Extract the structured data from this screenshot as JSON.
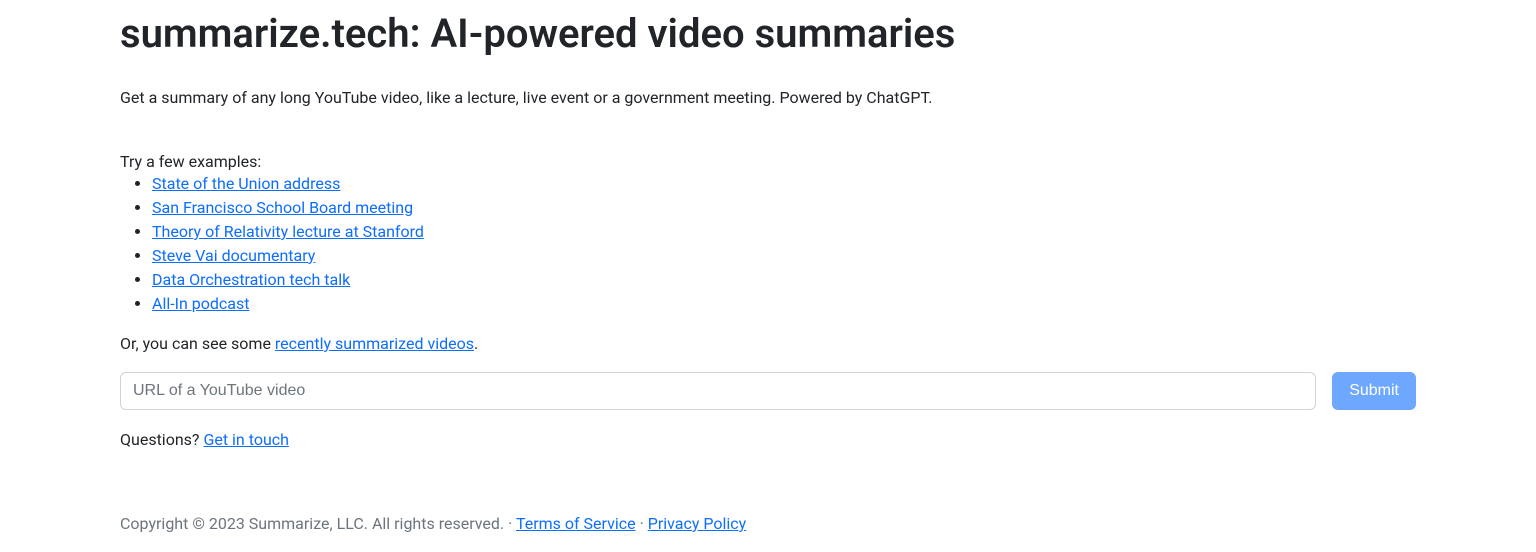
{
  "header": {
    "title": "summarize.tech: AI-powered video summaries"
  },
  "intro": "Get a summary of any long YouTube video, like a lecture, live event or a government meeting. Powered by ChatGPT.",
  "examples": {
    "prompt": "Try a few examples:",
    "items": [
      "State of the Union address",
      "San Francisco School Board meeting",
      "Theory of Relativity lecture at Stanford",
      "Steve Vai documentary",
      "Data Orchestration tech talk",
      "All-In podcast"
    ]
  },
  "recent": {
    "prefix": "Or, you can see some ",
    "link": "recently summarized videos",
    "suffix": "."
  },
  "form": {
    "placeholder": "URL of a YouTube video",
    "value": "",
    "submit": "Submit"
  },
  "contact": {
    "prefix": "Questions? ",
    "link": "Get in touch"
  },
  "footer": {
    "copyright": "Copyright © 2023 Summarize, LLC. All rights reserved.",
    "sep": " · ",
    "tos": "Terms of Service",
    "privacy": "Privacy Policy"
  }
}
